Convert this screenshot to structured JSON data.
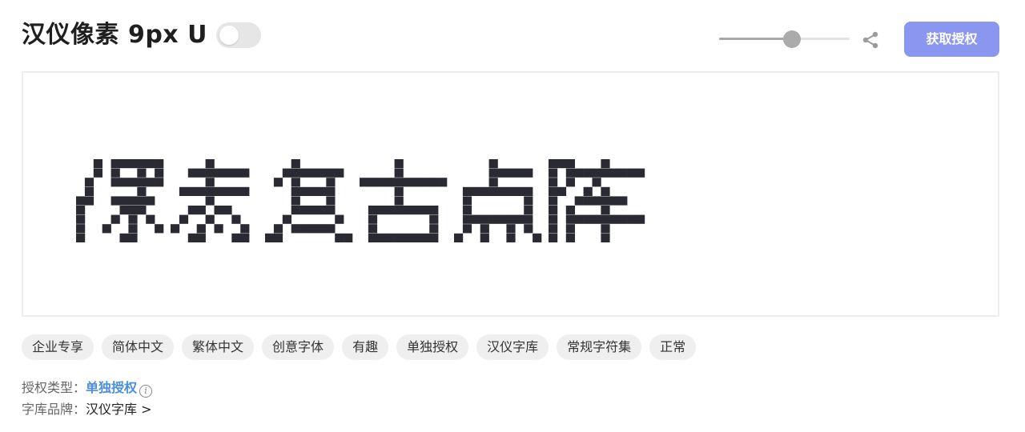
{
  "header": {
    "title": "汉仪像素 9px U",
    "toggle_on": false,
    "size_slider_value": 0.56,
    "license_button": "获取授权"
  },
  "preview": {
    "text": "像素复古点阵",
    "glyph_color": "#2a2a32"
  },
  "tags": [
    "企业专享",
    "简体中文",
    "繁体中文",
    "创意字体",
    "有趣",
    "单独授权",
    "汉仪字库",
    "常规字符集",
    "正常"
  ],
  "info": {
    "license_type_label": "授权类型：",
    "license_type_value": "单独授权",
    "brand_label": "字库品牌：",
    "brand_value": "汉仪字库 >"
  },
  "colors": {
    "accent": "#8a97f0",
    "link": "#4a8ee0",
    "tag_bg": "#efefef"
  },
  "icons": [
    "share-icon",
    "info-icon"
  ]
}
